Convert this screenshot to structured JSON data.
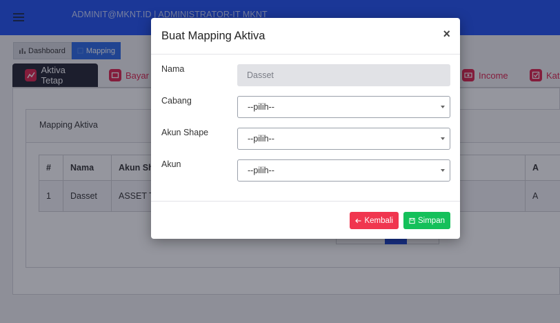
{
  "topbar": {
    "user_info": "ADMINIT@MKNT.ID | ADMINISTRATOR-IT MKNT",
    "menu_icon": "hamburger-menu-icon",
    "bg_color": "#2152f3"
  },
  "breadcrumb": {
    "dashboard_label": "Dashboard",
    "mapping_label": "Mapping"
  },
  "tabs": [
    {
      "label": "Aktiva Tetap",
      "icon": "chart-icon",
      "active": true
    },
    {
      "label": "Bayar",
      "icon": "wallet-icon",
      "active": false
    },
    {
      "label": "Income",
      "icon": "money-icon",
      "active": false
    },
    {
      "label": "Kat",
      "icon": "checkbox-icon",
      "active": false
    }
  ],
  "card": {
    "title": "Mapping Aktiva"
  },
  "table": {
    "headers": [
      "#",
      "Nama",
      "Akun Sh",
      "A"
    ],
    "rows": [
      [
        "1",
        "Dasset",
        "ASSET T",
        "A"
      ]
    ]
  },
  "modal": {
    "title": "Buat Mapping Aktiva",
    "close_symbol": "×",
    "fields": {
      "nama": {
        "label": "Nama",
        "value": "Dasset"
      },
      "cabang": {
        "label": "Cabang",
        "value": "--pilih--"
      },
      "akun_shape": {
        "label": "Akun Shape",
        "value": "--pilih--"
      },
      "akun": {
        "label": "Akun",
        "value": "--pilih--"
      }
    },
    "buttons": {
      "back_label": "Kembali",
      "save_label": "Simpan"
    }
  },
  "colors": {
    "accent_red": "#e0244e",
    "btn_back": "#f0364f",
    "btn_save": "#14c05a",
    "crumb_active": "#2a6be8"
  }
}
